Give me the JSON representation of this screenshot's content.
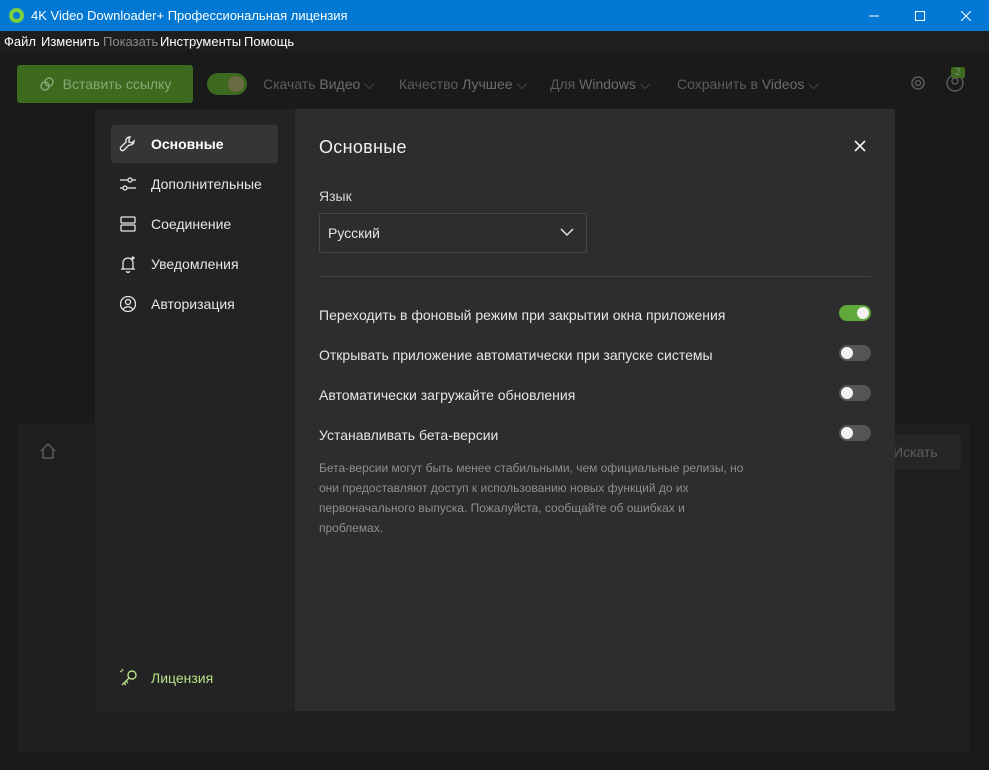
{
  "window": {
    "title": "4K Video Downloader+ Профессиональная лицензия"
  },
  "menubar": {
    "items": [
      {
        "label": "Файл",
        "disabled": false
      },
      {
        "label": "Изменить",
        "disabled": false
      },
      {
        "label": "Показать",
        "disabled": true
      },
      {
        "label": "Инструменты",
        "disabled": false
      },
      {
        "label": "Помощь",
        "disabled": false
      }
    ]
  },
  "toolbar": {
    "paste_label": "Вставить ссылку",
    "download_prefix": "Скачать",
    "download_value": "Видео",
    "quality_prefix": "Качество",
    "quality_value": "Лучшее",
    "for_prefix": "Для",
    "for_value": "Windows",
    "save_prefix": "Сохранить в",
    "save_value": "Videos",
    "badge": "2",
    "search_label": "Искать"
  },
  "settings": {
    "nav": [
      {
        "label": "Основные",
        "icon": "wrench-icon"
      },
      {
        "label": "Дополнительные",
        "icon": "sliders-icon"
      },
      {
        "label": "Соединение",
        "icon": "server-icon"
      },
      {
        "label": "Уведомления",
        "icon": "bell-icon"
      },
      {
        "label": "Авторизация",
        "icon": "user-circle-icon"
      }
    ],
    "license_label": "Лицензия",
    "title": "Основные",
    "language_label": "Язык",
    "language_value": "Русский",
    "options": [
      {
        "label": "Переходить в фоновый режим при закрытии окна приложения",
        "enabled": true
      },
      {
        "label": "Открывать приложение автоматически при запуске системы",
        "enabled": false
      },
      {
        "label": "Автоматически загружайте обновления",
        "enabled": false
      },
      {
        "label": "Устанавливать бета-версии",
        "enabled": false
      }
    ],
    "beta_note": "Бета-версии могут быть менее стабильными, чем официальные релизы, но они предоставляют доступ к использованию новых функций до их первоначального выпуска. Пожалуйста, сообщайте об ошибках и проблемах."
  },
  "colors": {
    "titlebar": "#0078d4",
    "accent_green": "#5fa83a",
    "license_green": "#b8e08a"
  }
}
